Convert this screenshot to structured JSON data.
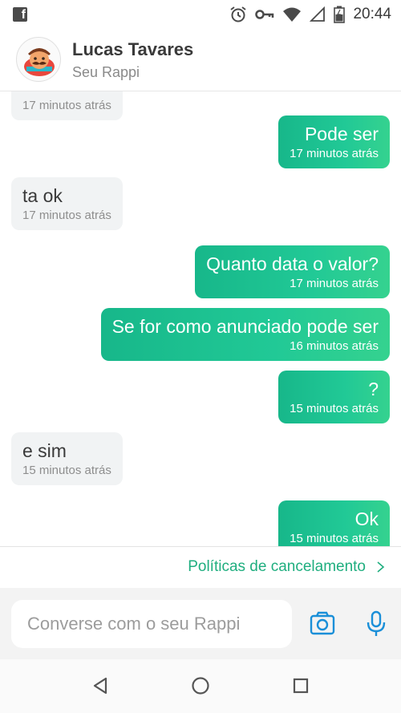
{
  "status_bar": {
    "time": "20:44",
    "icons": [
      "facebook-notification-icon",
      "alarm-icon",
      "vpn-key-icon",
      "wifi-icon",
      "signal-icon",
      "battery-icon"
    ]
  },
  "header": {
    "name": "Lucas Tavares",
    "subtitle": "Seu Rappi"
  },
  "messages": [
    {
      "direction": "incoming",
      "text": "",
      "time": "17 minutos atrás"
    },
    {
      "direction": "outgoing",
      "text": "Pode ser",
      "time": "17 minutos atrás"
    },
    {
      "direction": "incoming",
      "text": "ta ok",
      "time": "17 minutos atrás"
    },
    {
      "direction": "outgoing",
      "text": "Quanto data o valor?",
      "time": "17 minutos atrás"
    },
    {
      "direction": "outgoing",
      "text": "Se for como anunciado pode ser",
      "time": "16 minutos atrás"
    },
    {
      "direction": "outgoing",
      "text": "?",
      "time": "15 minutos atrás"
    },
    {
      "direction": "incoming",
      "text": "e sim",
      "time": "15 minutos atrás"
    },
    {
      "direction": "outgoing",
      "text": "Ok",
      "time": "15 minutos atrás"
    }
  ],
  "policies": {
    "label": "Políticas de cancelamento"
  },
  "composer": {
    "placeholder": "Converse com o seu Rappi"
  },
  "colors": {
    "accent": "#1fae7f",
    "bubble_outgoing_start": "#17b78a",
    "bubble_outgoing_end": "#35d28f",
    "bubble_incoming": "#f1f3f4"
  }
}
